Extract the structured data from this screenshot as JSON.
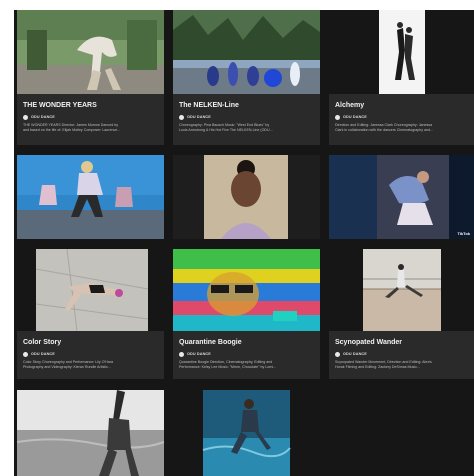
{
  "videos": [
    {
      "title": "THE WONDER YEARS",
      "creator": "ODU DANCE",
      "description_1": "THE WONDER YEARS Director: James Morrow Danced by",
      "description_2": "and based on the life of: Elijah Motley Composer: Laurence..."
    },
    {
      "title": "The NELKEN-Line",
      "creator": "ODU DANCE",
      "description_1": "Choreography: Pina Bausch Music: \"West End Blues\" by",
      "description_2": "Louis Armstrong & His Hot Five The NELKEN-Line (ODU..."
    },
    {
      "title": "Alchemy",
      "creator": "ODU DANCE",
      "description_1": "Direction and Editing: Janessa Clark Choreography: Janessa",
      "description_2": "Clark in collaboration with the dancers Cinematography and..."
    },
    {
      "title": "",
      "creator": "",
      "description_1": "",
      "description_2": ""
    },
    {
      "title": "",
      "creator": "",
      "description_1": "",
      "description_2": ""
    },
    {
      "title": "",
      "creator": "",
      "description_1": "",
      "description_2": "",
      "watermark": "TikTok"
    },
    {
      "title": "Color Story",
      "creator": "ODU DANCE",
      "description_1": "Color Story Choreography and Performance: Lily O'Hara",
      "description_2": "Photography and Videography: Kieran Rundle Artistic..."
    },
    {
      "title": "Quarantine Boogie",
      "creator": "ODU DANCE",
      "description_1": "Quarantine Boogie Direction, Cinematography, Editing and",
      "description_2": "Performance: Kelsy Lee Music: \"Mmm, Chocolate\" by Lorni..."
    },
    {
      "title": "Scynopated Wander",
      "creator": "ODU DANCE",
      "description_1": "Scynopated Wander Movement, Direction and Editing: Alexis",
      "description_2": "Horak Filming and Editing: Zackery DeSimas Music..."
    }
  ],
  "colors": {
    "page_background": "#ffffff",
    "grid_background": "#161616",
    "card_info_background": "#2a2a2a",
    "title_text": "#f2f2f2",
    "body_text": "#bdbdbd"
  }
}
